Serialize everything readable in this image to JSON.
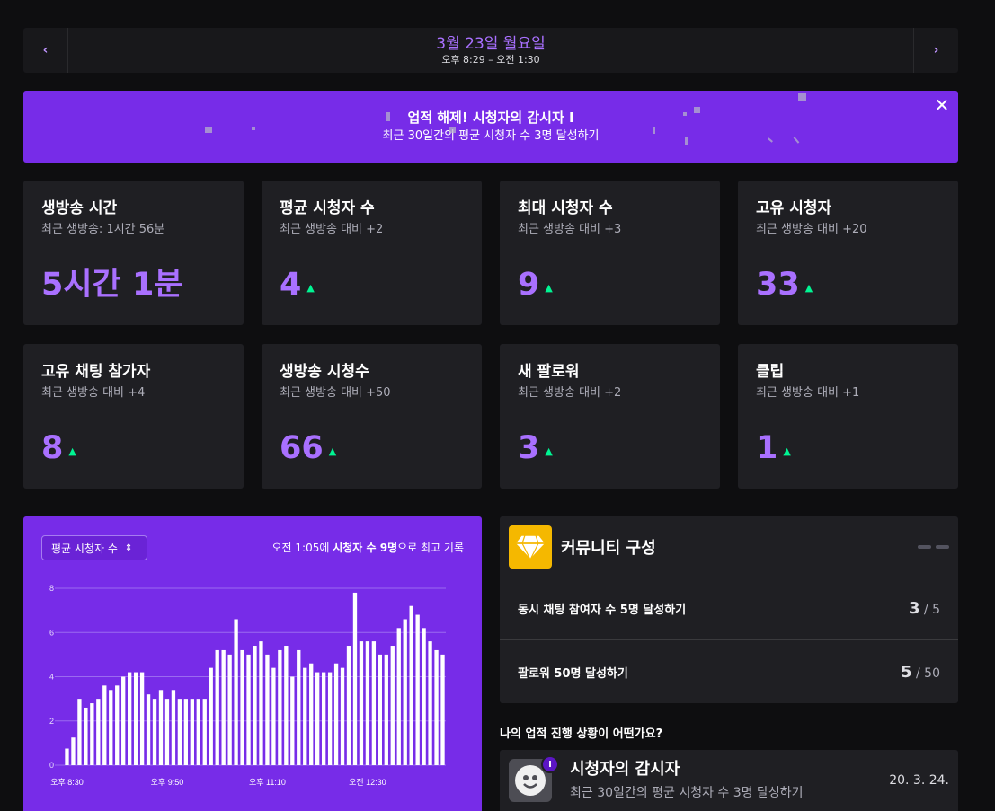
{
  "date_nav": {
    "prev": "‹",
    "next": "›",
    "date": "3월 23일 월요일",
    "time_range": "오후 8:29 – 오전 1:30"
  },
  "banner": {
    "title": "업적 해제! 시청자의 감시자 I",
    "subtitle": "최근 30일간의 평균 시청자 수 3명 달성하기",
    "close": "✕"
  },
  "stats": [
    {
      "title": "생방송 시간",
      "sub": "최근 생방송: 1시간 56분",
      "value": "5시간 1분",
      "trend": ""
    },
    {
      "title": "평균 시청자 수",
      "sub": "최근 생방송 대비 +2",
      "value": "4",
      "trend": "up"
    },
    {
      "title": "최대 시청자 수",
      "sub": "최근 생방송 대비 +3",
      "value": "9",
      "trend": "up"
    },
    {
      "title": "고유 시청자",
      "sub": "최근 생방송 대비 +20",
      "value": "33",
      "trend": "up"
    },
    {
      "title": "고유 채팅 참가자",
      "sub": "최근 생방송 대비 +4",
      "value": "8",
      "trend": "up"
    },
    {
      "title": "생방송 시청수",
      "sub": "최근 생방송 대비 +50",
      "value": "66",
      "trend": "up"
    },
    {
      "title": "새 팔로워",
      "sub": "최근 생방송 대비 +2",
      "value": "3",
      "trend": "up"
    },
    {
      "title": "클립",
      "sub": "최근 생방송 대비 +1",
      "value": "1",
      "trend": "up"
    }
  ],
  "chart_panel": {
    "select_label": "평균 시청자 수",
    "peak_prefix": "오전 1:05에 ",
    "peak_bold": "시청자 수 9명",
    "peak_suffix": "으로 최고 기록"
  },
  "chart_data": {
    "type": "bar",
    "ylim": [
      0,
      8
    ],
    "yticks": [
      0,
      2,
      4,
      6,
      8
    ],
    "xtick_labels": [
      "오후 8:30",
      "오후 9:50",
      "오후 11:10",
      "오전 12:30"
    ],
    "xtick_index": [
      0,
      16,
      32,
      48
    ],
    "values": [
      0.75,
      1.25,
      3.0,
      2.6,
      2.8,
      3.0,
      3.6,
      3.4,
      3.6,
      4.0,
      4.2,
      4.2,
      4.2,
      3.2,
      3.0,
      3.4,
      3.0,
      3.4,
      3.0,
      3.0,
      3.0,
      3.0,
      3.0,
      4.4,
      5.2,
      5.2,
      5.0,
      6.6,
      5.2,
      5.0,
      5.4,
      5.6,
      5.0,
      4.4,
      5.2,
      5.4,
      4.0,
      5.2,
      4.4,
      4.6,
      4.2,
      4.2,
      4.2,
      4.6,
      4.4,
      5.4,
      7.8,
      5.6,
      5.6,
      5.6,
      5.0,
      5.0,
      5.4,
      6.2,
      6.6,
      7.2,
      6.8,
      6.2,
      5.6,
      5.2,
      5.0
    ]
  },
  "community": {
    "title": "커뮤니티 구성",
    "rows": [
      {
        "label": "동시 채팅 참여자 수 5명 달성하기",
        "current": "3",
        "target": "/ 5"
      },
      {
        "label": "팔로워 50명 달성하기",
        "current": "5",
        "target": "/ 50"
      }
    ]
  },
  "progress_question": "나의 업적 진행 상황이 어떤가요?",
  "achievement": {
    "badge": "I",
    "title": "시청자의 감시자",
    "subtitle": "최근 30일간의 평균 시청자 수 3명 달성하기",
    "date": "20. 3. 24."
  },
  "colors": {
    "accent": "#a970ff",
    "banner_purple": "#772ce8",
    "trend_green": "#00f593",
    "card_bg": "#1f1f23",
    "page_bg": "#0e0e10"
  }
}
